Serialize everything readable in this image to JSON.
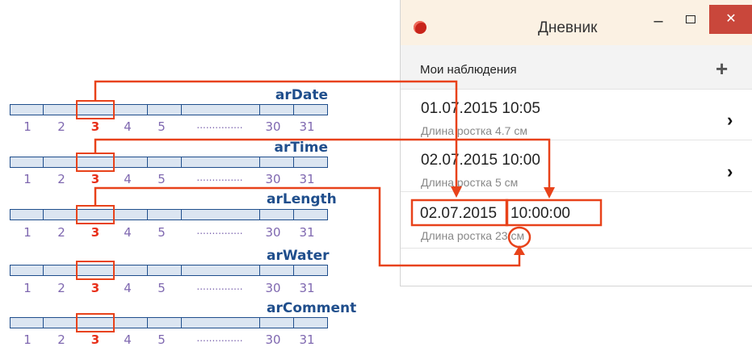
{
  "arrays": [
    {
      "name": "arDate"
    },
    {
      "name": "arTime"
    },
    {
      "name": "arLength"
    },
    {
      "name": "arWater"
    },
    {
      "name": "arComment"
    }
  ],
  "indices": [
    "1",
    "2",
    "3",
    "4",
    "5",
    "...............",
    "30",
    "31"
  ],
  "highlight_index": "3",
  "window": {
    "title": "Дневник",
    "minimize_label": "–",
    "close_label": "✕",
    "toolbar_title": "Мои наблюдения",
    "add_label": "+",
    "chevron": "›",
    "entries": [
      {
        "date": "01.07.2015 10:05",
        "sub": "Длина ростка 4.7 см"
      },
      {
        "date": "02.07.2015 10:00",
        "sub": "Длина ростка 5 см"
      },
      {
        "date": "02.07.2015",
        "time": "10:00:00",
        "sub_prefix": "Длина ростка",
        "sub_value": "23",
        "sub_suffix": "см"
      }
    ]
  },
  "colors": {
    "arrow": "#e8421a",
    "array_label": "#1f4e8c",
    "index": "#7f68b0",
    "highlight_index": "#e8301a",
    "close_button": "#c9473b"
  }
}
